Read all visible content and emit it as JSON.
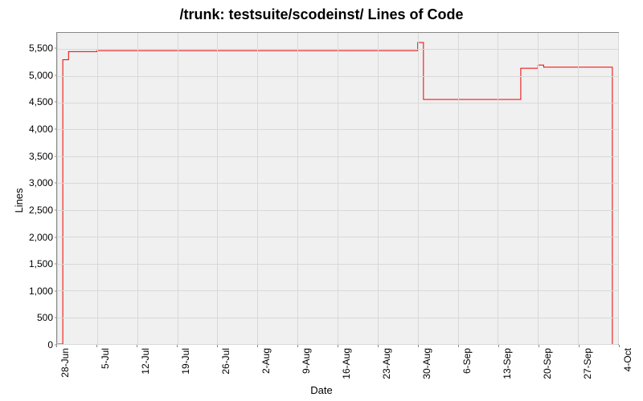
{
  "chart_data": {
    "type": "line",
    "title": "/trunk: testsuite/scodeinst/ Lines of Code",
    "xlabel": "Date",
    "ylabel": "Lines",
    "ylim": [
      0,
      5800
    ],
    "y_ticks": [
      0,
      500,
      1000,
      1500,
      2000,
      2500,
      3000,
      3500,
      4000,
      4500,
      5000,
      5500
    ],
    "y_tick_labels": [
      "0",
      "500",
      "1,000",
      "1,500",
      "2,000",
      "2,500",
      "3,000",
      "3,500",
      "4,000",
      "4,500",
      "5,000",
      "5,500"
    ],
    "x_tick_labels": [
      "28-Jun",
      "5-Jul",
      "12-Jul",
      "19-Jul",
      "26-Jul",
      "2-Aug",
      "9-Aug",
      "16-Aug",
      "23-Aug",
      "30-Aug",
      "6-Sep",
      "13-Sep",
      "20-Sep",
      "27-Sep",
      "4-Oct"
    ],
    "series": [
      {
        "name": "Lines of Code",
        "color": "#ee0000",
        "points": [
          {
            "date": "28-Jun",
            "value": 0
          },
          {
            "date": "29-Jun",
            "value": 0
          },
          {
            "date": "29-Jun",
            "value": 5300
          },
          {
            "date": "30-Jun",
            "value": 5300
          },
          {
            "date": "30-Jun",
            "value": 5450
          },
          {
            "date": "5-Jul",
            "value": 5450
          },
          {
            "date": "5-Jul",
            "value": 5470
          },
          {
            "date": "30-Aug",
            "value": 5470
          },
          {
            "date": "30-Aug",
            "value": 5620
          },
          {
            "date": "31-Aug",
            "value": 5620
          },
          {
            "date": "31-Aug",
            "value": 4560
          },
          {
            "date": "17-Sep",
            "value": 4560
          },
          {
            "date": "17-Sep",
            "value": 5140
          },
          {
            "date": "20-Sep",
            "value": 5140
          },
          {
            "date": "20-Sep",
            "value": 5200
          },
          {
            "date": "21-Sep",
            "value": 5200
          },
          {
            "date": "21-Sep",
            "value": 5160
          },
          {
            "date": "3-Oct",
            "value": 5160
          },
          {
            "date": "3-Oct",
            "value": 0
          }
        ]
      }
    ],
    "date_range": {
      "start_day": 0,
      "end_day": 98
    },
    "date_index": {
      "28-Jun": 0,
      "29-Jun": 1,
      "30-Jun": 2,
      "5-Jul": 7,
      "12-Jul": 14,
      "19-Jul": 21,
      "26-Jul": 28,
      "2-Aug": 35,
      "9-Aug": 42,
      "16-Aug": 49,
      "23-Aug": 56,
      "30-Aug": 63,
      "31-Aug": 64,
      "6-Sep": 70,
      "13-Sep": 77,
      "17-Sep": 81,
      "20-Sep": 84,
      "21-Sep": 85,
      "27-Sep": 91,
      "3-Oct": 97,
      "4-Oct": 98
    }
  }
}
